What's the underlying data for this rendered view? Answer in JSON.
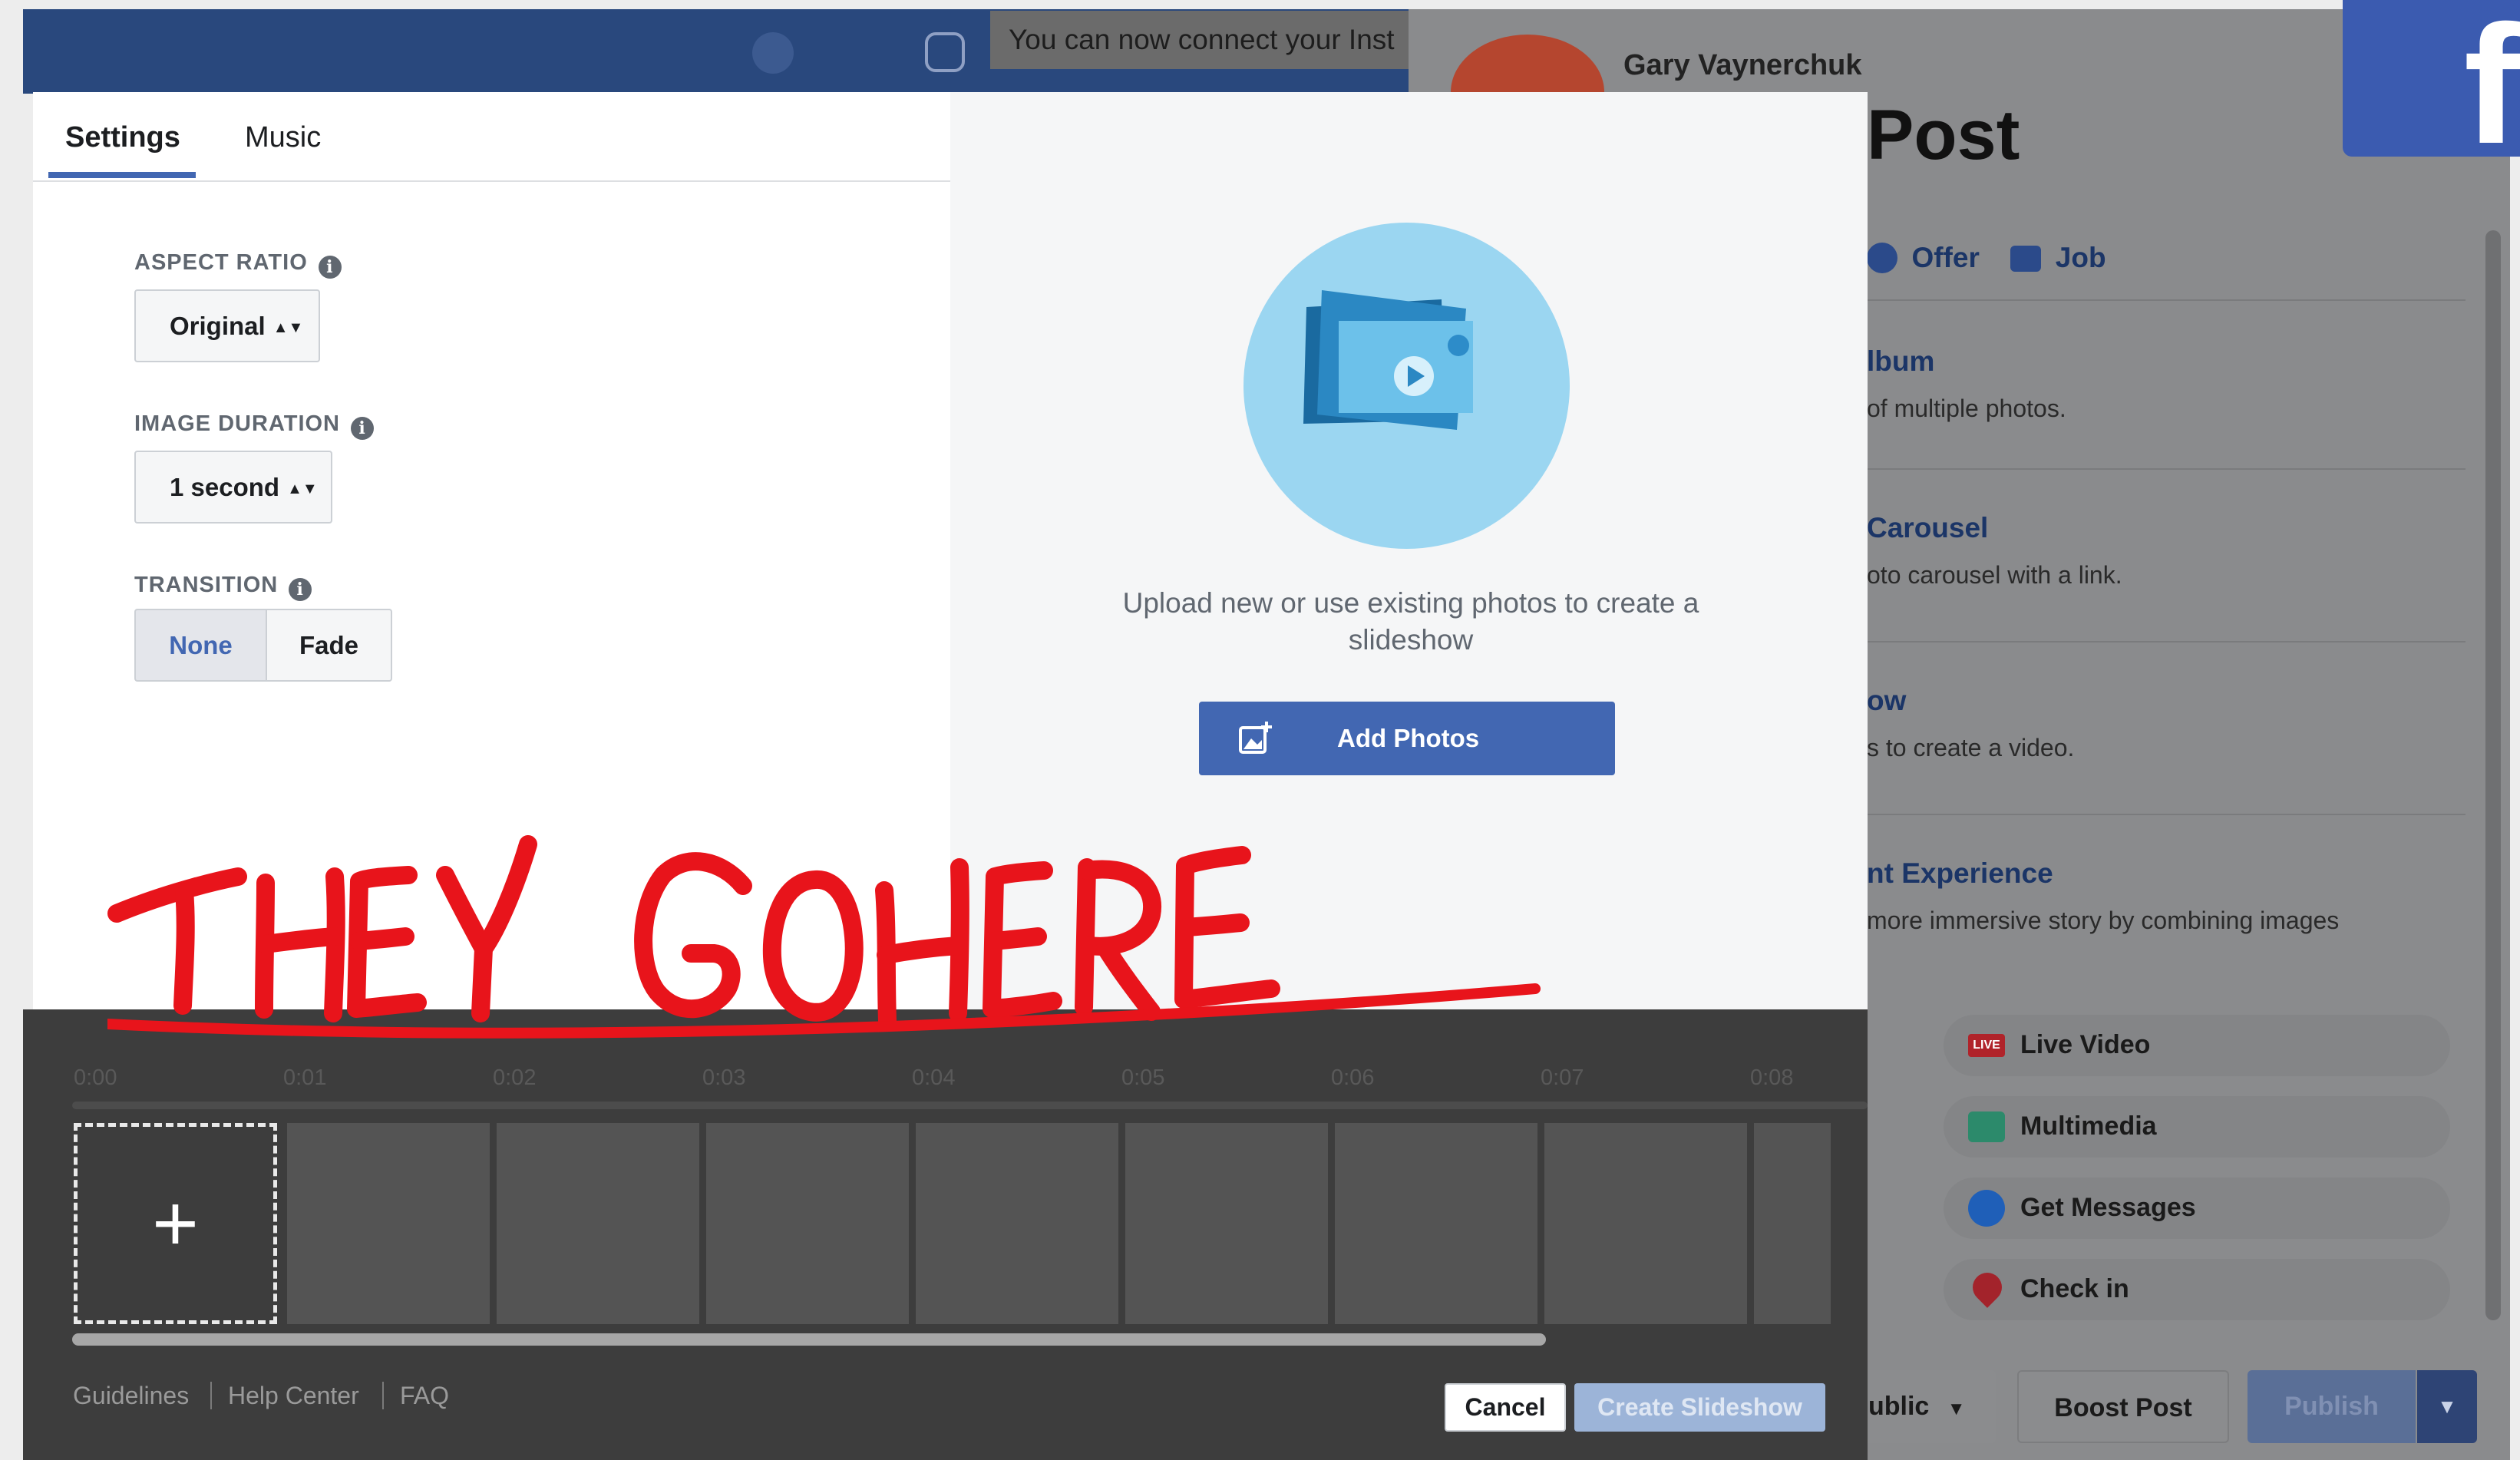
{
  "background": {
    "notice_text": "You can now connect your Inst",
    "user_name": "Gary Vaynerchuk",
    "post_title": "Post",
    "fb_logo": "f",
    "post_types": [
      "Offer",
      "Job"
    ],
    "options": [
      {
        "title": "lbum",
        "subtitle": "of multiple photos."
      },
      {
        "title": "Carousel",
        "subtitle": "oto carousel with a link."
      },
      {
        "title": "ow",
        "subtitle": "s to create a video."
      },
      {
        "title": "nt Experience",
        "subtitle": "more immersive story by combining images"
      }
    ],
    "chips": [
      {
        "label": "Live Video",
        "icon": "live-video-icon",
        "badge": "LIVE"
      },
      {
        "label": "Multimedia",
        "icon": "multimedia-icon"
      },
      {
        "label": "Get Messages",
        "icon": "messenger-icon"
      },
      {
        "label": "Check in",
        "icon": "location-pin-icon"
      }
    ],
    "audience_label": "ublic",
    "boost_label": "Boost Post",
    "publish_label": "Publish"
  },
  "modal": {
    "tabs": [
      "Settings",
      "Music"
    ],
    "aspect_ratio": {
      "label": "ASPECT RATIO",
      "value": "Original"
    },
    "image_duration": {
      "label": "IMAGE DURATION",
      "value": "1 second"
    },
    "transition": {
      "label": "TRANSITION",
      "options": [
        "None",
        "Fade"
      ],
      "selected": "None"
    },
    "upload_text": "Upload new or use existing photos to create a slideshow",
    "add_photos_label": "Add Photos",
    "annotation_text": "THEY GO HERE"
  },
  "timeline": {
    "ruler": [
      "0:00",
      "0:01",
      "0:02",
      "0:03",
      "0:04",
      "0:05",
      "0:06",
      "0:07",
      "0:08"
    ],
    "add_symbol": "+",
    "empty_slots": 8
  },
  "footer": {
    "links": [
      "Guidelines",
      "Help Center",
      "FAQ"
    ],
    "cancel_label": "Cancel",
    "create_label": "Create Slideshow"
  },
  "colors": {
    "facebook_blue": "#4267b2",
    "annotation_red": "#e8141b",
    "timeline_bg": "#3d3d3d"
  }
}
